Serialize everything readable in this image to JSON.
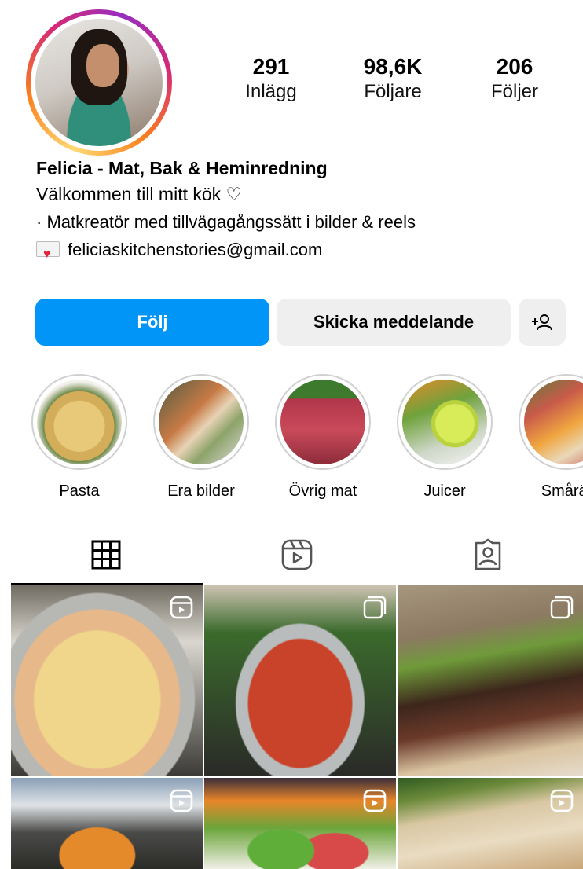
{
  "profile": {
    "stats": [
      {
        "value": "291",
        "label": "Inlägg"
      },
      {
        "value": "98,6K",
        "label": "Följare"
      },
      {
        "value": "206",
        "label": "Följer"
      }
    ],
    "name": "Felicia - Mat, Bak & Heminredning",
    "bio_line1": "Välkommen till mitt kök ♡",
    "bio_line2": "·  Matkreatör med tillvägagångssätt i bilder & reels",
    "email": "feliciaskitchenstories@gmail.com"
  },
  "actions": {
    "follow_label": "Följ",
    "message_label": "Skicka meddelande",
    "add_user_icon": "add-user-icon"
  },
  "highlights": [
    {
      "label": "Pasta"
    },
    {
      "label": "Era bilder"
    },
    {
      "label": "Övrig mat"
    },
    {
      "label": "Juicer"
    },
    {
      "label": "Smårät"
    }
  ],
  "tabs": [
    {
      "name": "grid",
      "icon": "grid-icon",
      "active": true
    },
    {
      "name": "reels",
      "icon": "reels-icon",
      "active": false
    },
    {
      "name": "tagged",
      "icon": "tagged-person-icon",
      "active": false
    }
  ],
  "posts": [
    {
      "type": "reel",
      "subject": "tortellini"
    },
    {
      "type": "carousel",
      "subject": "shakshuka"
    },
    {
      "type": "carousel",
      "subject": "steak-board"
    },
    {
      "type": "reel",
      "subject": "roasted-vegetables"
    },
    {
      "type": "reel",
      "subject": "dip-platter"
    },
    {
      "type": "reel",
      "subject": "flatbread"
    }
  ],
  "colors": {
    "follow_button": "#0095f6",
    "secondary_button": "#efefef",
    "story_ring": "#d62976"
  }
}
